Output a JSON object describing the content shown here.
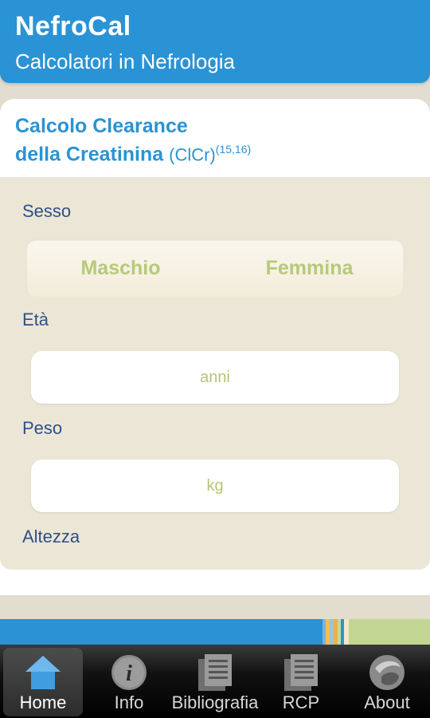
{
  "header": {
    "title": "NefroCal",
    "subtitle": "Calcolatori in Nefrologia"
  },
  "calculator": {
    "title_line1": "Calcolo Clearance",
    "title_line2": "della Creatinina",
    "title_abbrev": "(ClCr)",
    "title_refs": "(15,16)"
  },
  "form": {
    "sex_label": "Sesso",
    "sex_options": [
      "Maschio",
      "Femmina"
    ],
    "age_label": "Età",
    "age_placeholder": "anni",
    "weight_label": "Peso",
    "weight_placeholder": "kg",
    "height_label": "Altezza"
  },
  "tabs": [
    {
      "label": "Home",
      "icon": "home-icon",
      "active": true
    },
    {
      "label": "Info",
      "icon": "info-icon",
      "active": false
    },
    {
      "label": "Bibliografia",
      "icon": "document-icon",
      "active": false
    },
    {
      "label": "RCP",
      "icon": "document-icon",
      "active": false
    },
    {
      "label": "About",
      "icon": "about-icon",
      "active": false
    }
  ],
  "colors": {
    "brand_blue": "#2a93d5",
    "panel_beige": "#ebe6d6",
    "label_navy": "#2f4f8a",
    "accent_green": "#b7c97a"
  }
}
